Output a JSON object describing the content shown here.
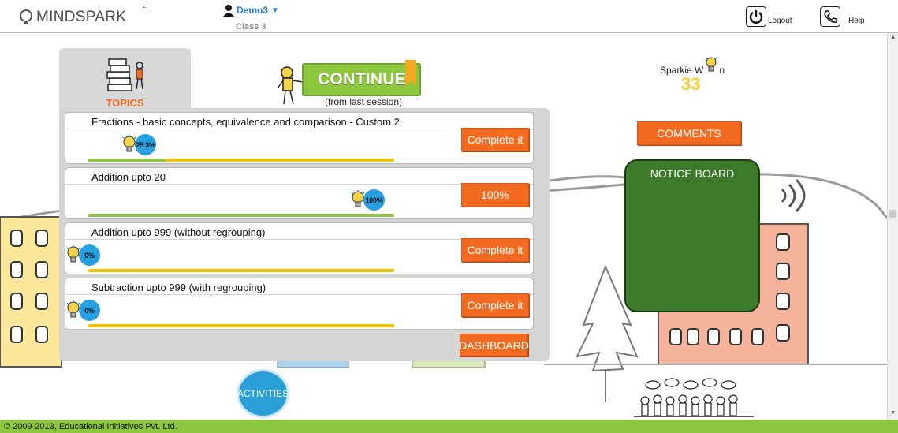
{
  "header": {
    "brand": "MINDSPARK",
    "brand_sup": "EI",
    "user_name": "Demo3",
    "user_class": "Class 3",
    "logout_label": "Logout",
    "help_label": "Help"
  },
  "topics_tab": {
    "label": "TOPICS"
  },
  "continue": {
    "label": "CONTINUE",
    "sub_label": "(from last session)"
  },
  "sparkie": {
    "label_left": "Sparkie W",
    "label_right": "n",
    "count": "33"
  },
  "comments_label": "COMMENTS",
  "notice_board": {
    "title": "NOTICE BOARD"
  },
  "topics": [
    {
      "title": "Fractions - basic concepts, equivalence and comparison - Custom 2",
      "percent_label": "25.3%",
      "progress": 25.3,
      "button": "Complete it"
    },
    {
      "title": "Addition upto 20",
      "percent_label": "100%",
      "progress": 100,
      "button": "100%"
    },
    {
      "title": "Addition upto 999 (without regrouping)",
      "percent_label": "0%",
      "progress": 0,
      "button": "Complete it"
    },
    {
      "title": "Subtraction upto 999 (with regrouping)",
      "percent_label": "0%",
      "progress": 0,
      "button": "Complete it"
    }
  ],
  "dashboard_label": "DASHBOARD",
  "activities_label": "ACTIVITIES",
  "footer": "© 2009-2013, Educational Initiatives Pvt. Ltd.",
  "colors": {
    "accent_orange": "#f26b21",
    "green": "#8dc63f",
    "blue": "#26a0e0",
    "notice_green": "#3d7a2a"
  }
}
